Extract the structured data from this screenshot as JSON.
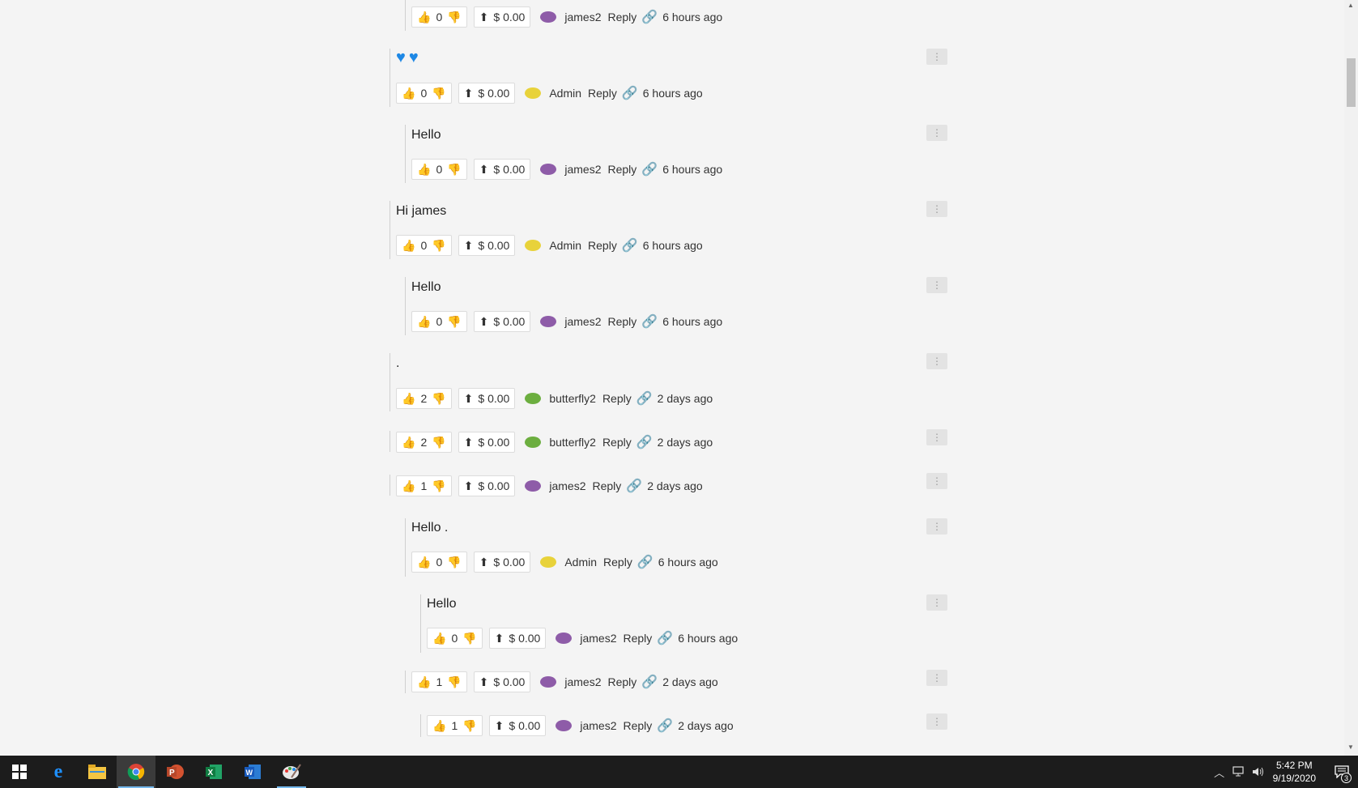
{
  "comments": [
    {
      "text": "",
      "likes": "0",
      "tip": "$ 0.00",
      "user": "james2",
      "avatar": "purple",
      "reply": "Reply",
      "time": "6 hours ago"
    },
    {
      "emoji": "💙💙",
      "likes": "0",
      "tip": "$ 0.00",
      "user": "Admin",
      "avatar": "yellow",
      "reply": "Reply",
      "time": "6 hours ago"
    },
    {
      "text": "Hello",
      "likes": "0",
      "tip": "$ 0.00",
      "user": "james2",
      "avatar": "purple",
      "reply": "Reply",
      "time": "6 hours ago"
    },
    {
      "text": "Hi james",
      "likes": "0",
      "tip": "$ 0.00",
      "user": "Admin",
      "avatar": "yellow",
      "reply": "Reply",
      "time": "6 hours ago"
    },
    {
      "text": "Hello",
      "likes": "0",
      "tip": "$ 0.00",
      "user": "james2",
      "avatar": "purple",
      "reply": "Reply",
      "time": "6 hours ago"
    },
    {
      "text": ".",
      "likes": "2",
      "tip": "$ 0.00",
      "user": "butterfly2",
      "avatar": "green",
      "reply": "Reply",
      "time": "2 days ago"
    },
    {
      "text": "",
      "likes": "2",
      "tip": "$ 0.00",
      "user": "butterfly2",
      "avatar": "green",
      "reply": "Reply",
      "time": "2 days ago"
    },
    {
      "text": "",
      "likes": "1",
      "tip": "$ 0.00",
      "user": "james2",
      "avatar": "purple",
      "reply": "Reply",
      "time": "2 days ago"
    },
    {
      "text": "Hello .",
      "likes": "0",
      "tip": "$ 0.00",
      "user": "Admin",
      "avatar": "yellow",
      "reply": "Reply",
      "time": "6 hours ago"
    },
    {
      "text": "Hello",
      "likes": "0",
      "tip": "$ 0.00",
      "user": "james2",
      "avatar": "purple",
      "reply": "Reply",
      "time": "6 hours ago"
    },
    {
      "text": "",
      "likes": "1",
      "tip": "$ 0.00",
      "user": "james2",
      "avatar": "purple",
      "reply": "Reply",
      "time": "2 days ago"
    },
    {
      "text": "",
      "likes": "1",
      "tip": "$ 0.00",
      "user": "james2",
      "avatar": "purple",
      "reply": "Reply",
      "time": "2 days ago"
    }
  ],
  "colors": {
    "purple": "#8e5ca8",
    "yellow": "#e8d23a",
    "green": "#6cae3f",
    "heart": "#1e88e5"
  },
  "taskbar": {
    "apps": [
      "windows-start",
      "edge",
      "file-explorer",
      "chrome",
      "powerpoint",
      "excel",
      "word",
      "paint"
    ],
    "time": "5:42 PM",
    "date": "9/19/2020",
    "notifications": "3"
  }
}
